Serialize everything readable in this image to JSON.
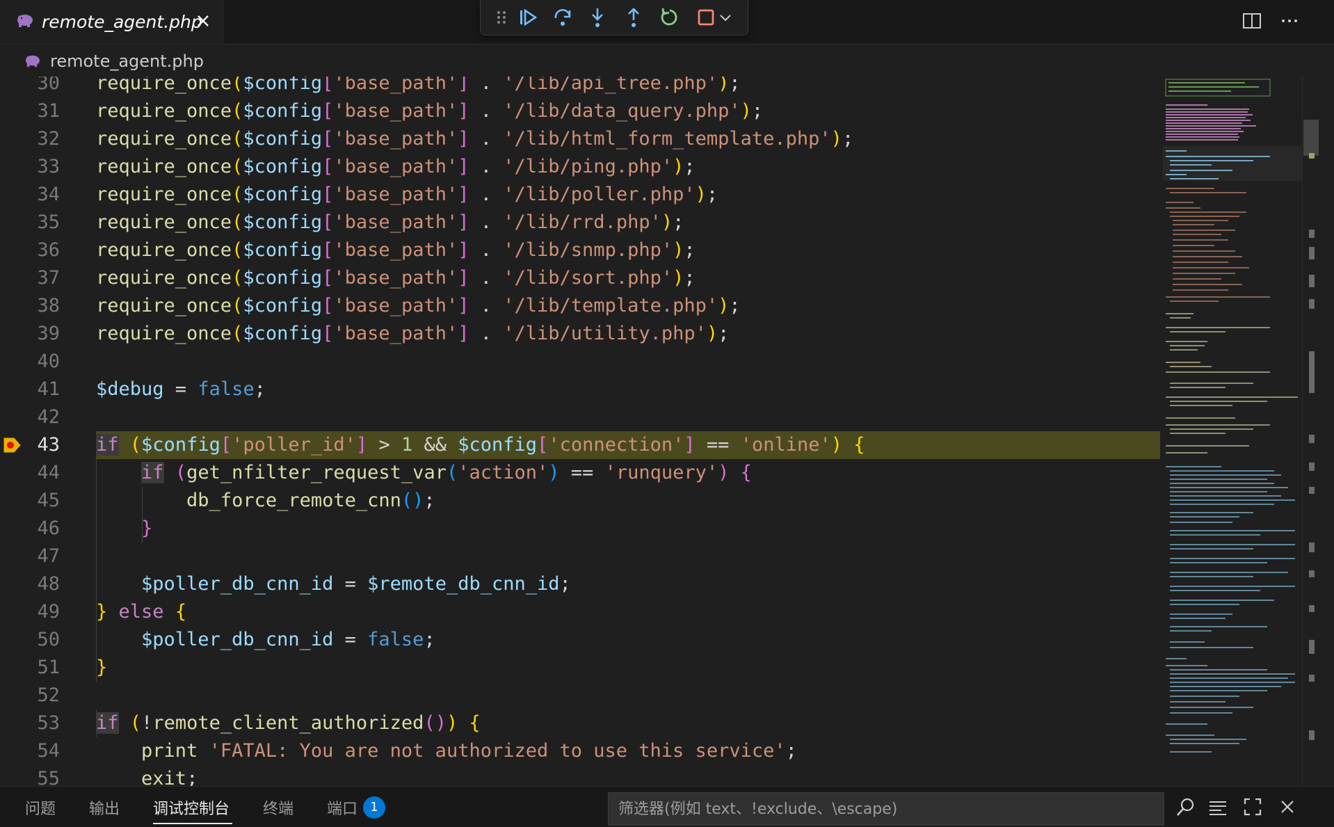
{
  "editor_tab": {
    "title": "remote_agent.php"
  },
  "breadcrumb": {
    "file": "remote_agent.php"
  },
  "code_lines": [
    {
      "n": "30"
    },
    {
      "n": "31"
    },
    {
      "n": "32"
    },
    {
      "n": "33"
    },
    {
      "n": "34"
    },
    {
      "n": "35"
    },
    {
      "n": "36"
    },
    {
      "n": "37"
    },
    {
      "n": "38"
    },
    {
      "n": "39"
    },
    {
      "n": "40"
    },
    {
      "n": "41"
    },
    {
      "n": "42"
    },
    {
      "n": "43"
    },
    {
      "n": "44"
    },
    {
      "n": "45"
    },
    {
      "n": "46"
    },
    {
      "n": "47"
    },
    {
      "n": "48"
    },
    {
      "n": "49"
    },
    {
      "n": "50"
    },
    {
      "n": "51"
    },
    {
      "n": "52"
    },
    {
      "n": "53"
    },
    {
      "n": "54"
    },
    {
      "n": "55"
    }
  ],
  "code": {
    "l30_path": "'/lib/api_tree.php'",
    "l31_path": "'/lib/data_query.php'",
    "l32_path": "'/lib/html_form_template.php'",
    "l33_path": "'/lib/ping.php'",
    "l34_path": "'/lib/poller.php'",
    "l35_path": "'/lib/rrd.php'",
    "l36_path": "'/lib/snmp.php'",
    "l37_path": "'/lib/sort.php'",
    "l38_path": "'/lib/template.php'",
    "l39_path": "'/lib/utility.php'",
    "require_fn": "require_once",
    "config_var": "$config",
    "base_path_key": "'base_path'",
    "dot": " . ",
    "debug_var": "$debug",
    "false_kw": "false",
    "if_kw": "if",
    "else_kw": "else",
    "poller_id_key": "'poller_id'",
    "gt_one": " > ",
    "one": "1",
    "and_op": " && ",
    "connection_key": "'connection'",
    "eq_op": " == ",
    "online_str": "'online'",
    "nfilter_fn": "get_nfilter_request_var",
    "action_str": "'action'",
    "runquery_str": "'runquery'",
    "force_fn": "db_force_remote_cnn",
    "poller_db_var": "$poller_db_cnn_id",
    "remote_db_var": "$remote_db_cnn_id",
    "authorized_fn": "remote_client_authorized",
    "print_kw": "print",
    "fatal_str": "'FATAL: You are not authorized to use this service'",
    "exit_kw": "exit"
  },
  "panel": {
    "tabs": [
      "问题",
      "输出",
      "调试控制台",
      "终端",
      "端口"
    ],
    "active_tab": "调试控制台",
    "ports_badge": "1",
    "filter_placeholder": "筛选器(例如 text、!exclude、\\escape)"
  },
  "colors": {
    "current_line": "#4b4a1e",
    "breakpoint": "#e51400",
    "accent": "#0078d4"
  },
  "icons": [
    "php-elephant-icon",
    "close-icon",
    "drag-handle-icon",
    "continue-icon",
    "step-over-icon",
    "step-into-icon",
    "step-out-icon",
    "restart-icon",
    "stop-icon",
    "chevron-down-icon",
    "split-editor-icon",
    "more-actions-icon",
    "search-icon",
    "word-wrap-icon",
    "maximize-icon",
    "close-panel-icon"
  ]
}
